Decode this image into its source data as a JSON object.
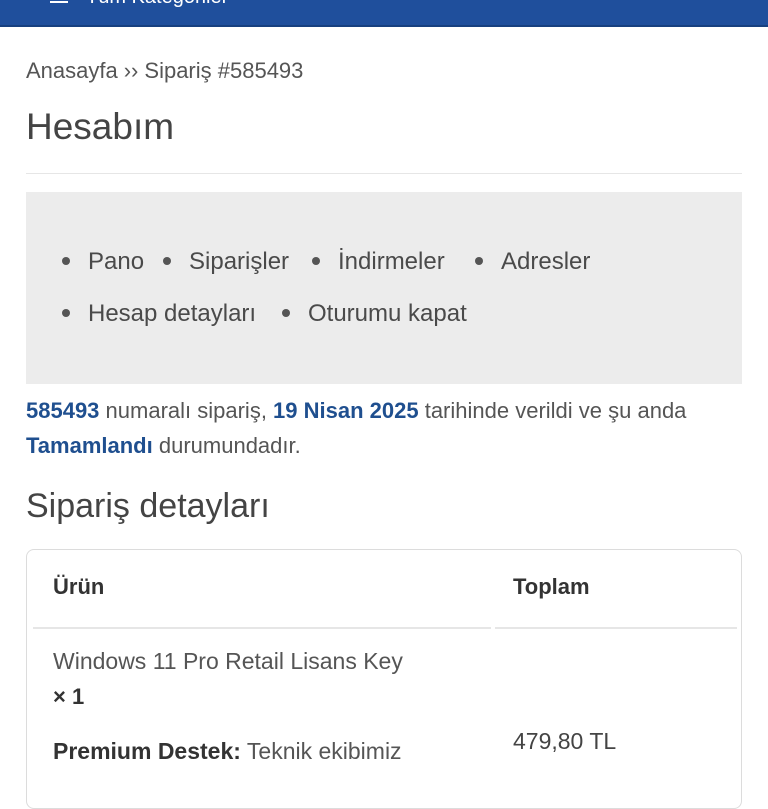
{
  "header": {
    "categories_label": "Tüm Kategoriler"
  },
  "breadcrumb": {
    "home": "Anasayfa",
    "separator": "››",
    "current": "Sipariş #585493"
  },
  "page_title": "Hesabım",
  "account_nav": {
    "items": [
      {
        "label": "Pano"
      },
      {
        "label": "Siparişler"
      },
      {
        "label": "İndirmeler"
      },
      {
        "label": "Adresler"
      },
      {
        "label": "Hesap detayları"
      },
      {
        "label": "Oturumu kapat"
      }
    ]
  },
  "order_message": {
    "order_number": "585493",
    "text_1": " numaralı sipariş, ",
    "date": "19 Nisan 2025",
    "text_2": " tarihinde verildi ve şu anda ",
    "status": "Tamamlandı",
    "text_3": " durumundadır."
  },
  "details": {
    "title": "Sipariş detayları",
    "columns": {
      "product": "Ürün",
      "total": "Toplam"
    },
    "item": {
      "name": "Windows 11 Pro Retail Lisans Key",
      "quantity": "× 1",
      "meta_label": "Premium Destek:",
      "meta_value": " Teknik ekibimiz",
      "total": "479,80 TL"
    }
  },
  "colors": {
    "header_bg": "#1f4f9c",
    "link_blue": "#1f4f8f",
    "nav_bg": "#ececec"
  }
}
